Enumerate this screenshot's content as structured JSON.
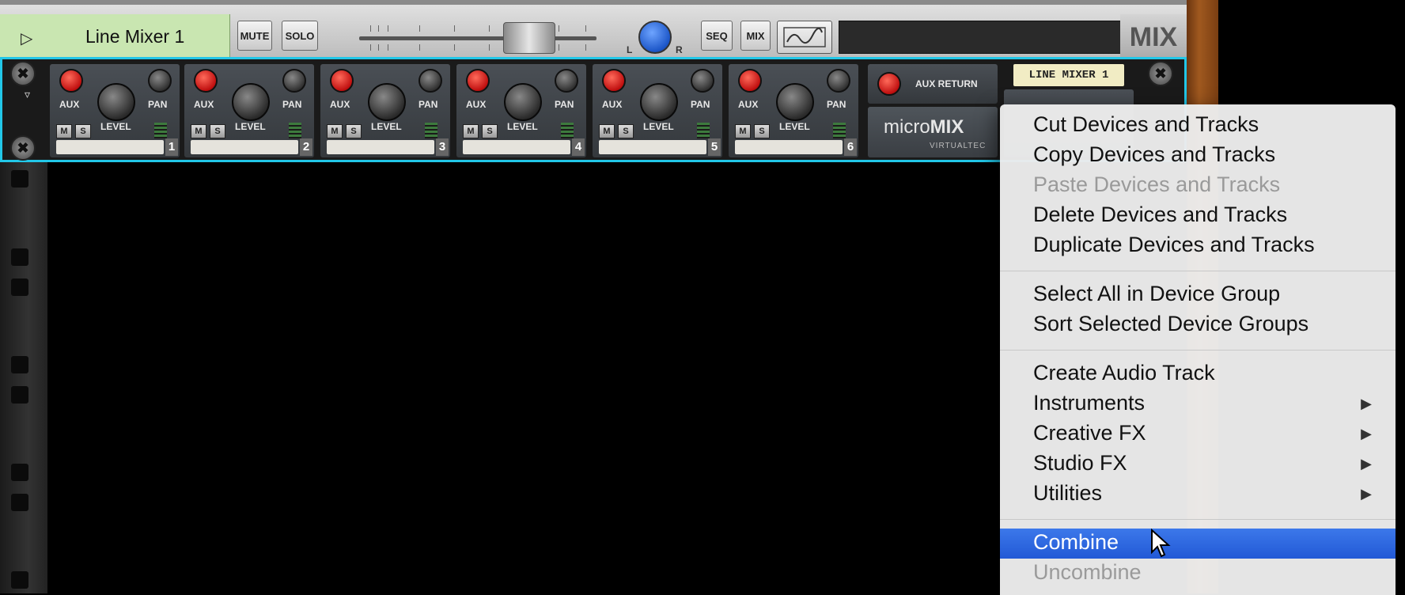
{
  "device_bar": {
    "device_name": "Line Mixer 1",
    "mute_label": "MUTE",
    "solo_label": "SOLO",
    "pan_left": "L",
    "pan_right": "R",
    "seq_label": "SEQ",
    "mix_label": "MIX",
    "mix_logo": "MIX"
  },
  "mixer": {
    "channels": [
      {
        "number": "1",
        "aux": "AUX",
        "pan": "PAN",
        "level": "LEVEL",
        "mute": "M",
        "solo": "S"
      },
      {
        "number": "2",
        "aux": "AUX",
        "pan": "PAN",
        "level": "LEVEL",
        "mute": "M",
        "solo": "S"
      },
      {
        "number": "3",
        "aux": "AUX",
        "pan": "PAN",
        "level": "LEVEL",
        "mute": "M",
        "solo": "S"
      },
      {
        "number": "4",
        "aux": "AUX",
        "pan": "PAN",
        "level": "LEVEL",
        "mute": "M",
        "solo": "S"
      },
      {
        "number": "5",
        "aux": "AUX",
        "pan": "PAN",
        "level": "LEVEL",
        "mute": "M",
        "solo": "S"
      },
      {
        "number": "6",
        "aux": "AUX",
        "pan": "PAN",
        "level": "LEVEL",
        "mute": "M",
        "solo": "S"
      }
    ],
    "aux_return": "AUX RETURN",
    "brand_light": "micro",
    "brand_bold": "MIX",
    "brand_sub": "VIRTUALTEC",
    "device_label": "LINE MIXER 1"
  },
  "context_menu": {
    "group1": [
      {
        "label": "Cut Devices and Tracks",
        "enabled": true
      },
      {
        "label": "Copy Devices and Tracks",
        "enabled": true
      },
      {
        "label": "Paste Devices and Tracks",
        "enabled": false
      },
      {
        "label": "Delete Devices and Tracks",
        "enabled": true
      },
      {
        "label": "Duplicate Devices and Tracks",
        "enabled": true
      }
    ],
    "group2": [
      {
        "label": "Select All in Device Group",
        "enabled": true
      },
      {
        "label": "Sort Selected Device Groups",
        "enabled": true
      }
    ],
    "group3": [
      {
        "label": "Create Audio Track",
        "enabled": true,
        "submenu": false
      },
      {
        "label": "Instruments",
        "enabled": true,
        "submenu": true
      },
      {
        "label": "Creative FX",
        "enabled": true,
        "submenu": true
      },
      {
        "label": "Studio FX",
        "enabled": true,
        "submenu": true
      },
      {
        "label": "Utilities",
        "enabled": true,
        "submenu": true
      }
    ],
    "group4": [
      {
        "label": "Combine",
        "enabled": true,
        "highlighted": true
      },
      {
        "label": "Uncombine",
        "enabled": false
      }
    ],
    "highlight_color": "#2d66e0"
  }
}
